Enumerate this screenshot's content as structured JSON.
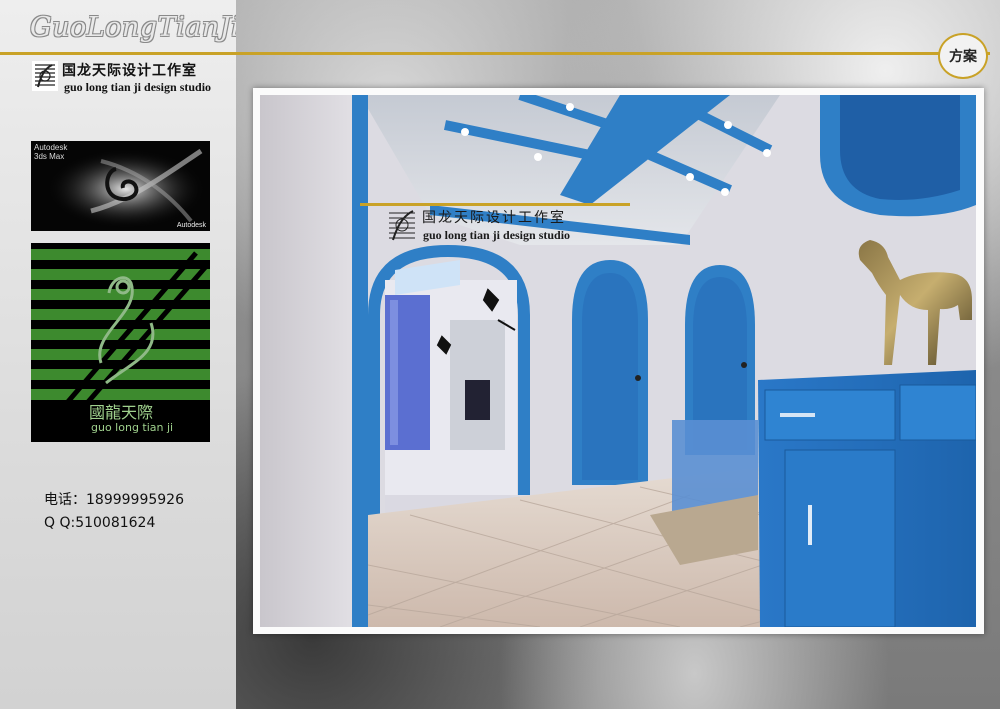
{
  "brand": {
    "title": "GuoLongTianJi"
  },
  "studio": {
    "name_cn": "国龙天际设计工作室",
    "name_en": "guo long tian ji design studio"
  },
  "software_logo": {
    "vendor": "Autodesk",
    "product": "3ds Max",
    "footer": "Autodesk"
  },
  "green_logo": {
    "name_cn": "國龍天際",
    "name_en": "guo long tian ji"
  },
  "contact": {
    "phone": "电话：18999995926",
    "qq": "Q  Q:510081624"
  },
  "badge": {
    "label": "方案"
  },
  "watermark": {
    "name_cn": "国龙天际设计工作室",
    "name_en": "guo long tian ji design studio"
  },
  "colors": {
    "gold": "#c9a227",
    "blue": "#2f7fc6",
    "green": "#3d8a2e"
  }
}
